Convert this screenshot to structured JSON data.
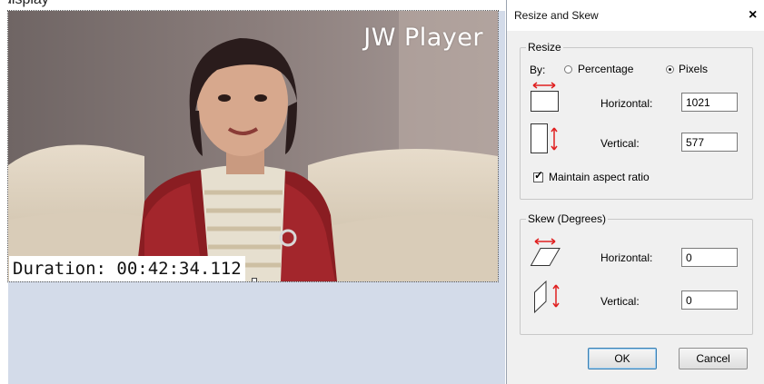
{
  "canvas": {
    "top_fragment": "display",
    "watermark": "JW Player",
    "duration_text": "Duration: 00:42:34.112",
    "background": "#d3dbe9"
  },
  "dialog": {
    "title": "Resize and Skew",
    "close_label": "×",
    "resize": {
      "legend": "Resize",
      "by_label": "By:",
      "percentage_label": "Percentage",
      "pixels_label": "Pixels",
      "selected_unit": "Pixels",
      "horizontal_label": "Horizontal:",
      "horizontal_value": "1021",
      "vertical_label": "Vertical:",
      "vertical_value": "577",
      "maintain_label": "Maintain aspect ratio",
      "maintain_checked": true
    },
    "skew": {
      "legend": "Skew (Degrees)",
      "horizontal_label": "Horizontal:",
      "horizontal_value": "0",
      "vertical_label": "Vertical:",
      "vertical_value": "0"
    },
    "ok_label": "OK",
    "cancel_label": "Cancel"
  },
  "colors": {
    "arrow_red": "#e02020",
    "button_default_border": "#3c7fb1"
  },
  "icons": {
    "resize_horizontal": "resize-horizontal-icon",
    "resize_vertical": "resize-vertical-icon",
    "skew_horizontal": "skew-horizontal-icon",
    "skew_vertical": "skew-vertical-icon"
  }
}
